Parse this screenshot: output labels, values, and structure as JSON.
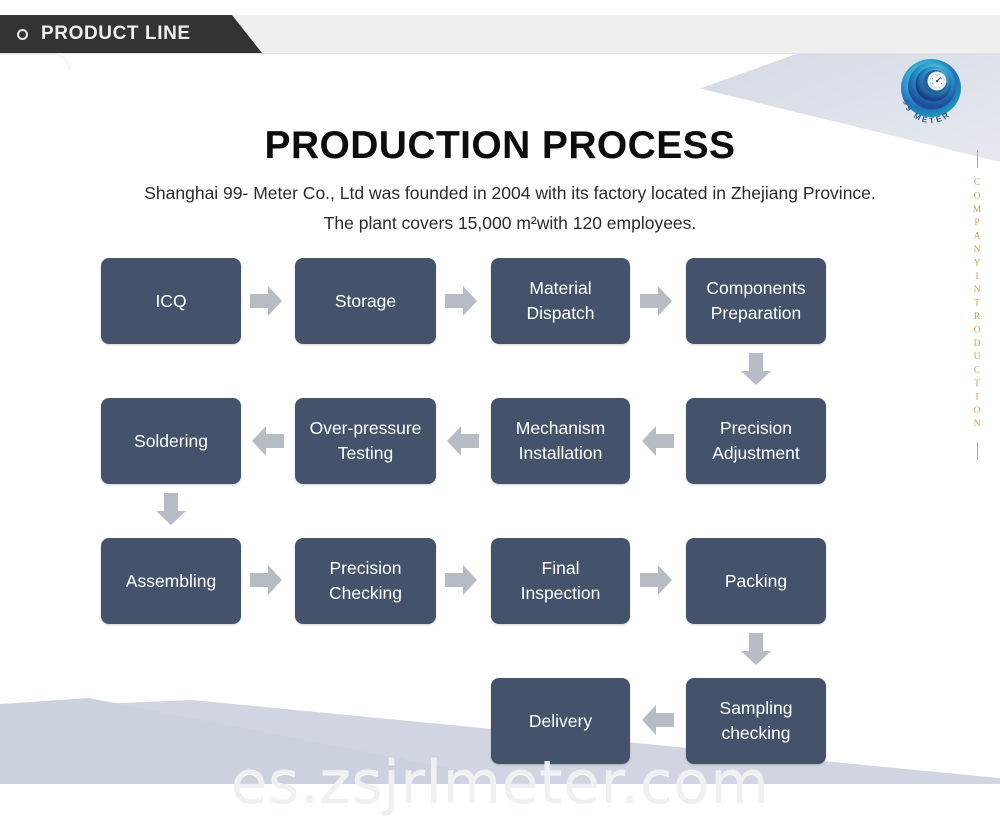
{
  "header": {
    "tab_label": "PRODUCT LINE",
    "bullet_icon": "circle-outline-icon"
  },
  "brand": {
    "logo_icon": "99-meter-swirl-logo",
    "logo_text": "99 METER",
    "logo_colors": {
      "outer": "#2e8fc4",
      "mid": "#1db7c9",
      "inner": "#2f6fbf",
      "deep": "#1a3f7a"
    }
  },
  "side_rail": {
    "vertical_text": "COMPANYINTRODUCTION",
    "color": "#c2a157"
  },
  "main": {
    "title": "PRODUCTION PROCESS",
    "description": "Shanghai 99- Meter Co., Ltd was founded in 2004 with its factory located in Zhejiang Province. The plant covers 15,000 m²with 120 employees."
  },
  "flow": {
    "box_color": "#44536b",
    "arrow_color": "#b7bbc4",
    "rows": [
      {
        "direction": "right",
        "boxes": [
          {
            "label": "ICQ"
          },
          {
            "label": "Storage"
          },
          {
            "label": "Material\nDispatch"
          },
          {
            "label": "Components\nPreparation"
          }
        ]
      },
      {
        "direction": "left",
        "boxes": [
          {
            "label": "Soldering"
          },
          {
            "label": "Over-pressure\nTesting"
          },
          {
            "label": "Mechanism\nInstallation"
          },
          {
            "label": "Precision\nAdjustment"
          }
        ]
      },
      {
        "direction": "right",
        "boxes": [
          {
            "label": "Assembling"
          },
          {
            "label": "Precision\nChecking"
          },
          {
            "label": "Final\nInspection"
          },
          {
            "label": "Packing"
          }
        ]
      },
      {
        "direction": "left",
        "boxes": [
          {
            "label": "Delivery"
          },
          {
            "label": "Sampling\nchecking"
          }
        ]
      }
    ],
    "connectors": [
      {
        "name": "components-preparation-to-precision-adjustment",
        "type": "down"
      },
      {
        "name": "soldering-to-assembling",
        "type": "down"
      },
      {
        "name": "packing-to-sampling-checking",
        "type": "down"
      }
    ]
  },
  "watermark": {
    "text": "es.zsjrlmeter.com"
  }
}
